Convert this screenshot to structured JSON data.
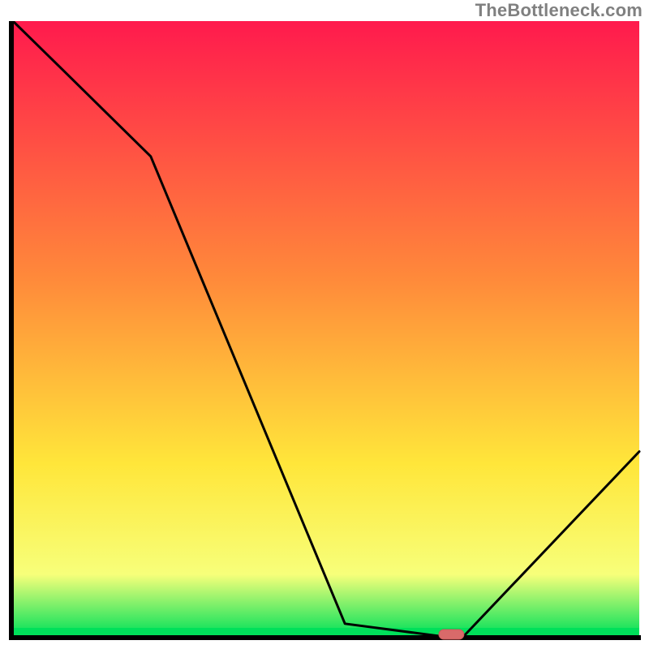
{
  "watermark": "TheBottleneck.com",
  "colors": {
    "gradient_top": "#ff1a4d",
    "gradient_mid1": "#ff8a3a",
    "gradient_mid2": "#ffe63a",
    "gradient_mid3": "#f7ff7a",
    "gradient_bottom": "#00e05a",
    "axis": "#000000",
    "line": "#000000",
    "marker_fill": "#d96a6a",
    "marker_stroke": "#c95858"
  },
  "chart_data": {
    "type": "line",
    "x": [
      0,
      8,
      22,
      53,
      68,
      72,
      100
    ],
    "values": [
      100,
      92,
      78,
      2,
      0,
      0,
      30
    ],
    "title": "",
    "xlabel": "",
    "ylabel": "",
    "xlim": [
      0,
      100
    ],
    "ylim": [
      0,
      100
    ],
    "marker": {
      "x_start": 68,
      "x_end": 72,
      "y": 0
    },
    "notes": "Values read visually: curve starts at top-left (100%), slight convex bend near x≈22, descends to a flat minimum (~0%) between x≈68–72 where a small rounded coral marker sits on the baseline, then rises roughly linearly to ~30% at x=100."
  }
}
